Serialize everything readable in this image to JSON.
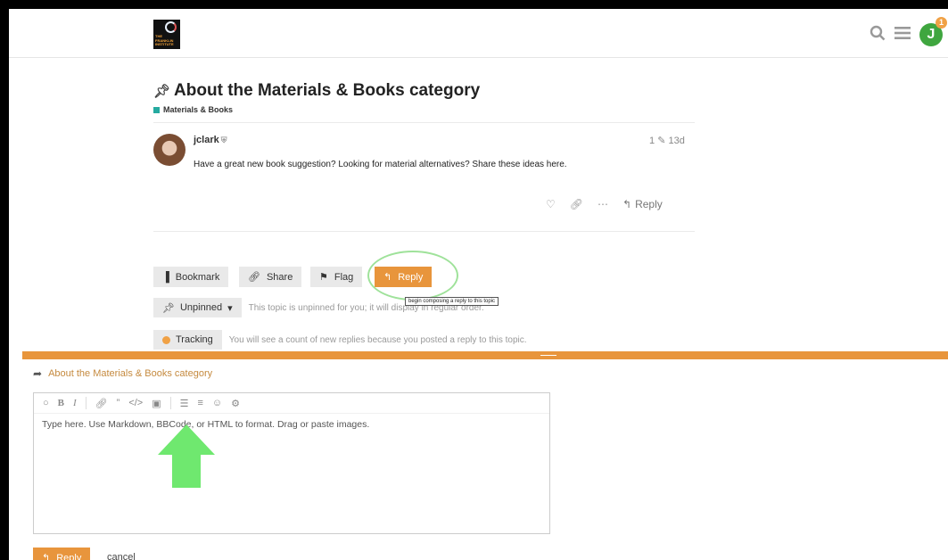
{
  "header": {
    "logo_text": "THE FRANKLIN INSTITUTE",
    "search_icon": "search-icon",
    "menu_icon": "hamburger-icon",
    "user_initial": "J",
    "notification_count": "1"
  },
  "topic": {
    "pin_icon": "pin-icon",
    "title": "About the Materials & Books category",
    "category": "Materials & Books",
    "category_color": "#25aaa0"
  },
  "post": {
    "username": "jclark",
    "edit_count": "1",
    "age": "13d",
    "body": "Have a great new book suggestion? Looking for material alternatives? Share these ideas here.",
    "reply_label": "Reply"
  },
  "topic_buttons": {
    "bookmark": "Bookmark",
    "share": "Share",
    "flag": "Flag",
    "reply": "Reply",
    "reply_tooltip": "begin composing a reply to this topic"
  },
  "notifications": {
    "pin_button": "Unpinned",
    "pin_text": "This topic is unpinned for you; it will display in regular order.",
    "tracking_button": "Tracking",
    "tracking_text": "You will see a count of new replies because you posted a reply to this topic."
  },
  "composer": {
    "reply_to": "About the Materials & Books category",
    "placeholder": "Type here. Use Markdown, BBCode, or HTML to format. Drag or paste images.",
    "submit_label": "Reply",
    "cancel_label": "cancel",
    "accent_color": "#e8953c"
  }
}
